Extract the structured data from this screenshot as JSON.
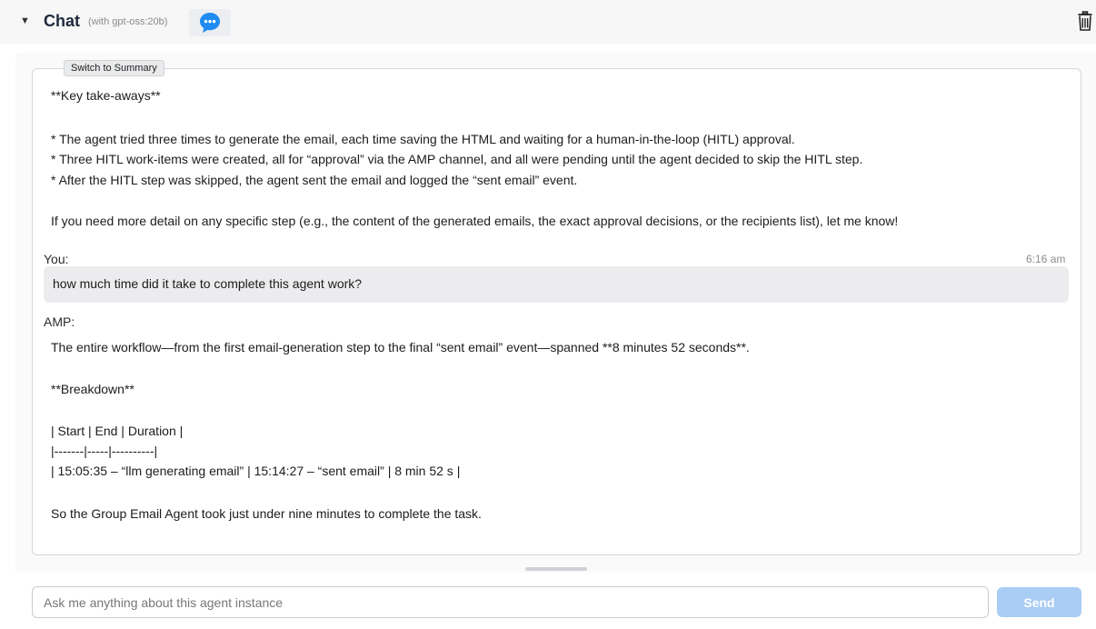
{
  "header": {
    "title": "Chat",
    "model": "(with gpt-oss:20b)",
    "caret_icon": "triangle-down",
    "chat_icon": "speech-bubble-ellipsis",
    "trash_icon": "trash-can",
    "accent_color": "#1f8bf0"
  },
  "transcript": {
    "switch_label": "Switch to Summary",
    "prev_reply": {
      "heading": "**Key take-aways**",
      "bullets": [
        "* The agent tried three times to generate the email, each time saving the HTML and waiting for a human-in-the-loop (HITL) approval.",
        "* Three HITL work-items were created, all for “approval” via the AMP channel, and all were pending until the agent decided to skip the HITL step.",
        "* After the HITL step was skipped, the agent sent the email and logged the “sent email” event."
      ],
      "closing": "If you need more detail on any specific step (e.g., the content of the generated emails, the exact approval decisions, or the recipients list), let me know!"
    },
    "user_message": {
      "label": "You:",
      "time": "6:16 am",
      "text": "how much time did it take to complete this agent work?"
    },
    "amp_reply": {
      "label": "AMP:",
      "lines": [
        "The entire workflow—from the first email-generation step to the final “sent email” event—spanned **8 minutes 52 seconds**.",
        "**Breakdown**",
        "| Start | End | Duration |",
        "|-------|-----|----------|",
        "| 15:05:35 – “llm generating email” | 15:14:27 – “sent email” | 8 min 52 s |",
        "So the Group Email Agent took just under nine minutes to complete the task."
      ]
    }
  },
  "composer": {
    "placeholder": "Ask me anything about this agent instance",
    "value": "",
    "send_label": "Send",
    "send_color": "#a9cdf5"
  }
}
